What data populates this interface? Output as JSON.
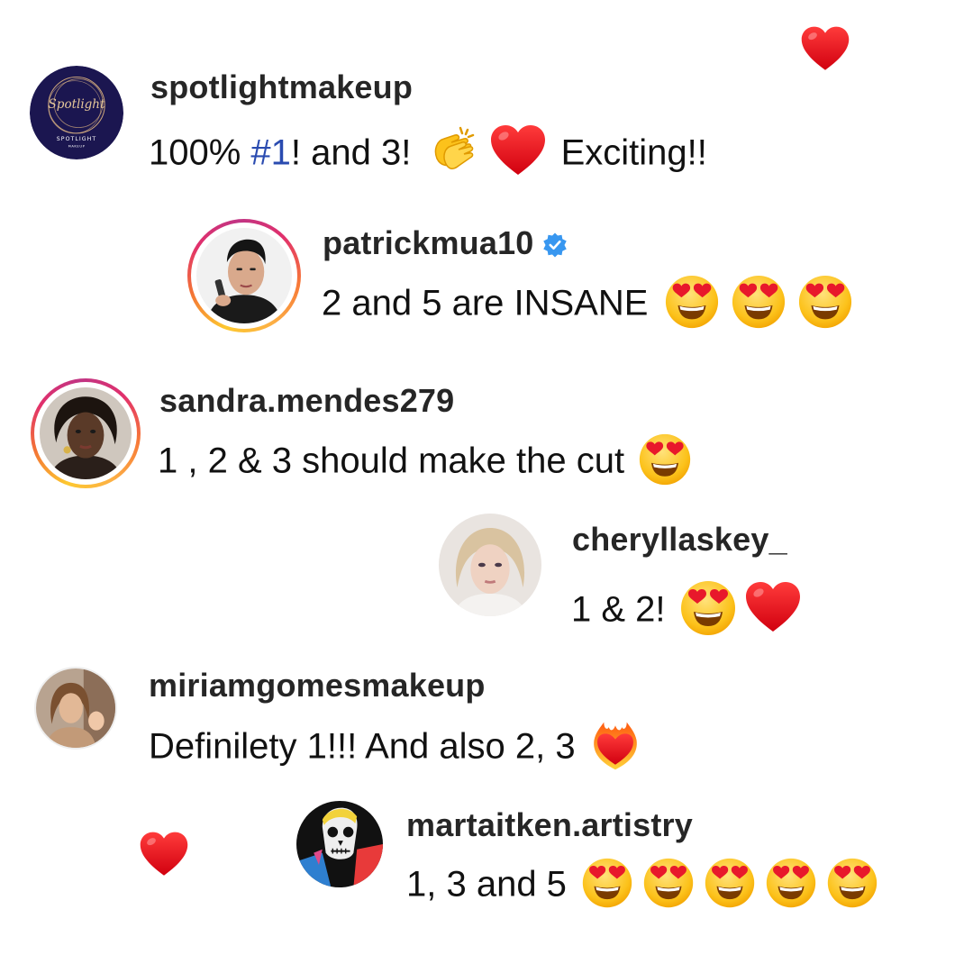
{
  "comments": [
    {
      "username": "spotlightmakeup",
      "avatar": {
        "icon": "spotlight-logo-avatar",
        "logo_text": "Spotlight",
        "logo_sub": "SPOTLIGHT",
        "logo_sub2": "MAKEUP"
      },
      "text_before": "100% ",
      "hashtag": "#1",
      "text_after": "! and 3! ",
      "text_end": " Exciting!!",
      "emojis": [
        "clapping-hands-emoji",
        "red-heart-emoji"
      ]
    },
    {
      "username": "patrickmua10",
      "verified": true,
      "avatar": {
        "icon": "profile-photo-avatar",
        "story_ring": true
      },
      "text": "2 and 5 are INSANE ",
      "emojis": [
        "heart-eyes-emoji",
        "heart-eyes-emoji",
        "heart-eyes-emoji"
      ]
    },
    {
      "username": "sandra.mendes279",
      "avatar": {
        "icon": "profile-photo-avatar",
        "story_ring": true
      },
      "text": "1 , 2 & 3 should make the cut ",
      "emojis": [
        "heart-eyes-emoji"
      ]
    },
    {
      "username": "cheryllaskey_",
      "avatar": {
        "icon": "profile-photo-avatar"
      },
      "text": "1 & 2! ",
      "emojis": [
        "heart-eyes-emoji",
        "red-heart-emoji"
      ]
    },
    {
      "username": "miriamgomesmakeup",
      "avatar": {
        "icon": "profile-photo-avatar"
      },
      "text": "Definilety 1!!! And also 2, 3 ",
      "emojis": [
        "heart-on-fire-emoji"
      ]
    },
    {
      "username": "martaitken.artistry",
      "avatar": {
        "icon": "profile-photo-avatar"
      },
      "text": "1, 3 and 5 ",
      "emojis": [
        "heart-eyes-emoji",
        "heart-eyes-emoji",
        "heart-eyes-emoji",
        "heart-eyes-emoji",
        "heart-eyes-emoji"
      ]
    }
  ],
  "decorations": [
    "red-heart-icon",
    "red-heart-icon"
  ],
  "colors": {
    "hashtag": "#2a4bb0",
    "verified": "#3897f0",
    "heart": "#e0141e",
    "story_ring": [
      "#fdc830",
      "#e1306c",
      "#c13584"
    ]
  }
}
